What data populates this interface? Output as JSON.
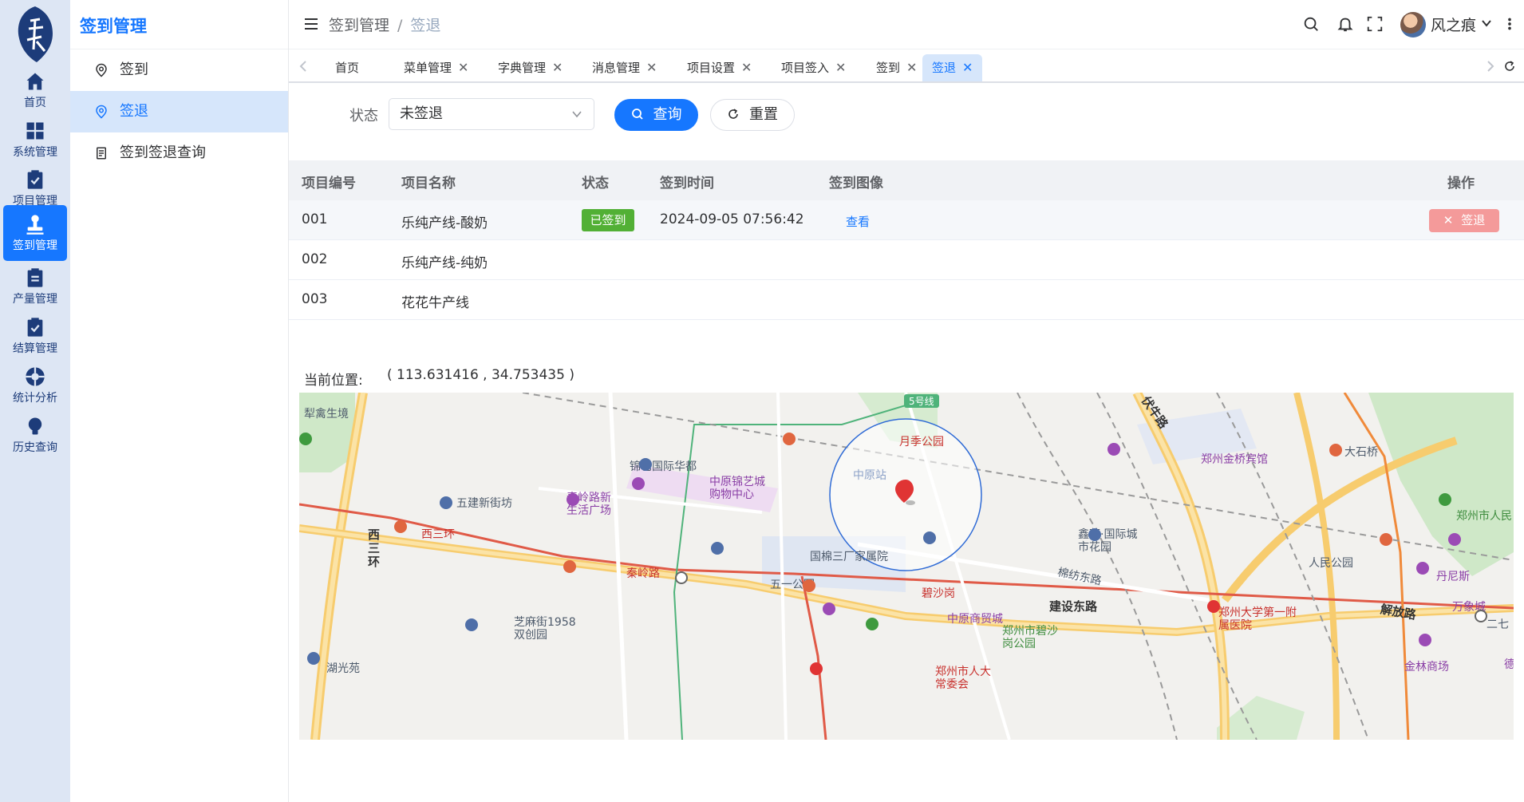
{
  "rail": {
    "items": [
      {
        "label": "首页"
      },
      {
        "label": "系统管理"
      },
      {
        "label": "项目管理"
      },
      {
        "label": "签到管理"
      },
      {
        "label": "产量管理"
      },
      {
        "label": "结算管理"
      },
      {
        "label": "统计分析"
      },
      {
        "label": "历史查询"
      }
    ],
    "active_index": 3
  },
  "submenu": {
    "title": "签到管理",
    "items": [
      {
        "label": "签到"
      },
      {
        "label": "签退"
      },
      {
        "label": "签到签退查询"
      }
    ]
  },
  "header": {
    "breadcrumb": [
      "签到管理",
      "签退"
    ],
    "user_name": "风之痕"
  },
  "tabs": [
    {
      "label": "首页"
    },
    {
      "label": "菜单管理"
    },
    {
      "label": "字典管理"
    },
    {
      "label": "消息管理"
    },
    {
      "label": "项目设置"
    },
    {
      "label": "项目签入"
    },
    {
      "label": "签到"
    },
    {
      "label": "签退"
    }
  ],
  "filter": {
    "status_label": "状态",
    "status_value": "未签退",
    "query_label": "查询",
    "reset_label": "重置"
  },
  "table": {
    "headers": [
      "项目编号",
      "项目名称",
      "状态",
      "签到时间",
      "签到图像",
      "操作"
    ],
    "rows": [
      {
        "code": "001",
        "name": "乐纯产线-酸奶",
        "status": "已签到",
        "time": "2024-09-05 07:56:42",
        "image": "查看",
        "action": "签退"
      },
      {
        "code": "002",
        "name": "乐纯产线-纯奶",
        "status": "",
        "time": "",
        "image": "",
        "action": ""
      },
      {
        "code": "003",
        "name": "花花牛产线",
        "status": "",
        "time": "",
        "image": "",
        "action": ""
      }
    ]
  },
  "location": {
    "label": "当前位置:",
    "value": "( 113.631416 , 34.753435 )"
  },
  "map": {
    "labels": {
      "l1": "5号线",
      "l2": "月季公园",
      "l3": "中原站",
      "l4": "锦艺国际华都",
      "l5": "中原锦艺城购物中心",
      "l6": "五建新街坊",
      "l7": "秦岭路新生活广场",
      "l8": "西三环",
      "l9": "秦岭路",
      "l10": "五一公园",
      "l11": "碧沙岗",
      "l12": "国棉三厂家属院",
      "l13": "鑫苑·国际城市花园",
      "l14": "棉纺东路",
      "l15": "建设东路",
      "l16": "中原商贸城",
      "l17": "郑州市碧沙岗公园",
      "l18": "芝麻街1958双创园",
      "l19": "湖光苑",
      "l20": "郑州市人大常委会",
      "l21": "郑州金桥宾馆",
      "l22": "大石桥",
      "l23": "人民公园",
      "l24": "郑州市人民",
      "l25": "丹尼斯",
      "l26": "万象城",
      "l27": "郑州大学第一附属医院",
      "l28": "解放路",
      "l29": "金林商场",
      "l30": "二七",
      "l31": "犁禽生境",
      "l32": "西三环",
      "l33": "伏牛路",
      "l34": "德"
    }
  },
  "colors": {
    "accent": "#1677ff",
    "success": "#52b035",
    "danger_light": "#f49a9a",
    "rail_bg": "#dde6f4"
  }
}
